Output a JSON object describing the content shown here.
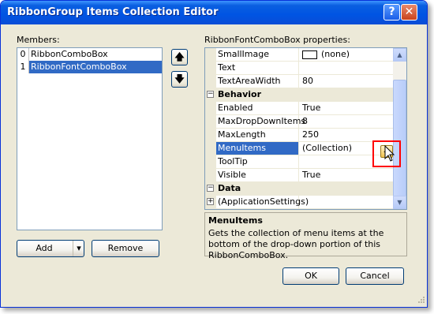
{
  "window": {
    "title": "RibbonGroup Items Collection Editor"
  },
  "titlebar": {
    "help_glyph": "?",
    "close_glyph": "✕"
  },
  "members": {
    "label": "Members:",
    "items": [
      {
        "index": "0",
        "name": "RibbonComboBox",
        "selected": false
      },
      {
        "index": "1",
        "name": "RibbonFontComboBox",
        "selected": true
      }
    ]
  },
  "move_up": {
    "glyph": "🡅",
    "icon": "arrow-up-icon"
  },
  "move_down": {
    "glyph": "🡇",
    "icon": "arrow-down-icon"
  },
  "properties": {
    "label": "RibbonFontComboBox properties:",
    "rows": [
      {
        "name": "SmallImage",
        "value": "(none)"
      },
      {
        "name": "Text",
        "value": ""
      },
      {
        "name": "TextAreaWidth",
        "value": "80"
      },
      {
        "category": "Behavior",
        "expander": "−"
      },
      {
        "name": "Enabled",
        "value": "True"
      },
      {
        "name": "MaxDropDownItems",
        "value": "8"
      },
      {
        "name": "MaxLength",
        "value": "250"
      },
      {
        "name": "MenuItems",
        "value": "(Collection)",
        "selected": true
      },
      {
        "name": "ToolTip",
        "value": ""
      },
      {
        "name": "Visible",
        "value": "True"
      },
      {
        "category": "Data",
        "expander": "−"
      },
      {
        "name": "(ApplicationSettings)",
        "value": "",
        "expander": "+"
      }
    ],
    "ellipsis_glyph": "..."
  },
  "description": {
    "title": "MenuItems",
    "text": "Gets the collection of menu items at the bottom of the drop-down portion of this RibbonComboBox."
  },
  "buttons": {
    "add": "Add",
    "add_dropdown": "▾",
    "remove": "Remove",
    "ok": "OK",
    "cancel": "Cancel"
  },
  "colors": {
    "selection": "#316ac5",
    "titlebar": "#0054e3",
    "highlight_box": "#ff0000"
  }
}
